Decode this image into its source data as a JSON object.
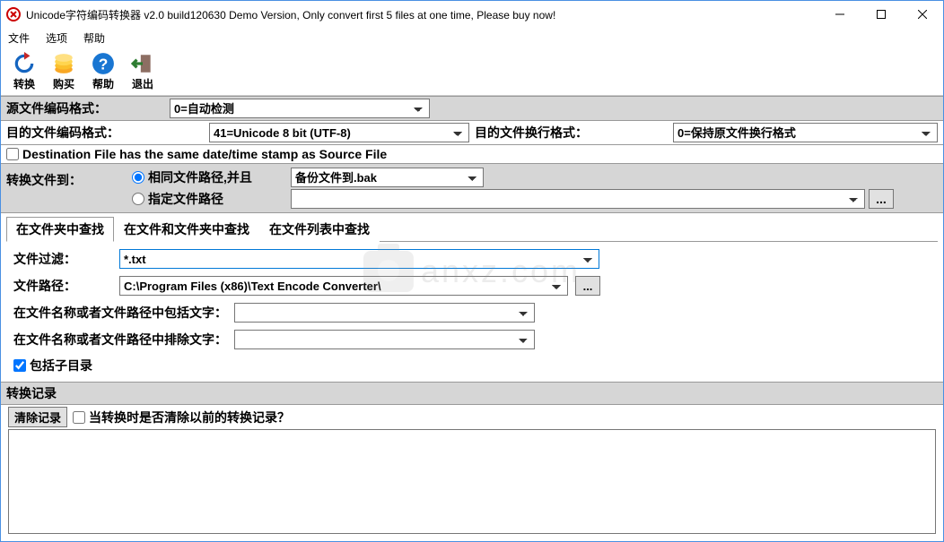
{
  "window": {
    "title": "Unicode字符编码转换器 v2.0 build120630 Demo Version, Only convert first 5 files at one time, Please buy now!"
  },
  "menubar": {
    "file": "文件",
    "options": "选项",
    "help": "帮助"
  },
  "toolbar": {
    "convert": "转换",
    "buy": "购买",
    "helpBtn": "帮助",
    "exit": "退出"
  },
  "sourceEncoding": {
    "label": "源文件编码格式：",
    "value": "0=自动检测"
  },
  "destEncoding": {
    "label": "目的文件编码格式：",
    "value": "41=Unicode 8 bit (UTF-8)",
    "lineEndLabel": "目的文件换行格式：",
    "lineEndValue": "0=保持原文件换行格式"
  },
  "sameDateCheck": "Destination File has the same date/time stamp as Source File",
  "convertTo": {
    "label": "转换文件到：",
    "radioSame": "相同文件路径,并且",
    "backupValue": "备份文件到.bak",
    "radioSpecify": "指定文件路径",
    "browse": "..."
  },
  "tabs": {
    "t1": "在文件夹中查找",
    "t2": "在文件和文件夹中查找",
    "t3": "在文件列表中查找"
  },
  "filterPanel": {
    "filterLabel": "文件过滤：",
    "filterValue": "*.txt",
    "pathLabel": "文件路径：",
    "pathValue": "C:\\Program Files (x86)\\Text Encode Converter\\",
    "browse": "...",
    "includeLabel": "在文件名称或者文件路径中包括文字：",
    "excludeLabel": "在文件名称或者文件路径中排除文字：",
    "includeSub": "包括子目录"
  },
  "records": {
    "header": "转换记录",
    "clearBtn": "清除记录",
    "clearCheck": "当转换时是否清除以前的转换记录？"
  },
  "watermark": "anxz.com"
}
